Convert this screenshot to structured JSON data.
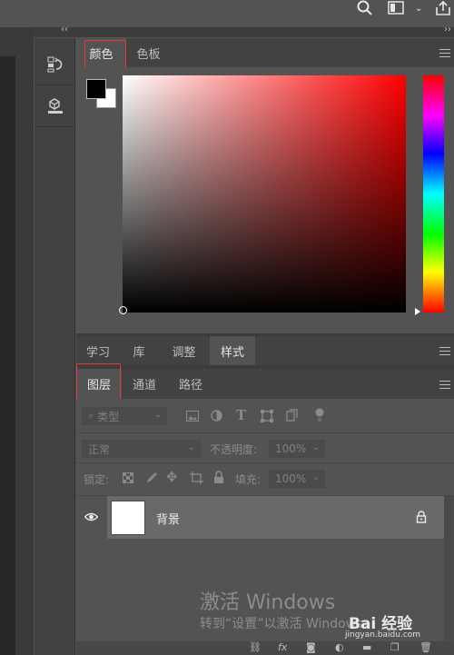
{
  "topbar": {
    "icons": [
      "search-icon",
      "workspace-icon",
      "chevron-down-icon",
      "share-icon"
    ]
  },
  "collapse": {
    "left": "‹‹",
    "right": "››"
  },
  "dock": {
    "items": [
      "history-icon",
      "3d-panel-icon"
    ]
  },
  "color_panel": {
    "tabs": [
      {
        "label": "颜色"
      },
      {
        "label": "色板"
      }
    ],
    "foreground": "#000000",
    "background": "#ffffff"
  },
  "mid_tabs": [
    {
      "label": "学习"
    },
    {
      "label": "库"
    },
    {
      "label": "调整"
    },
    {
      "label": "样式"
    }
  ],
  "layers_panel": {
    "tabs": [
      {
        "label": "图层"
      },
      {
        "label": "通道"
      },
      {
        "label": "路径"
      }
    ],
    "filter_placeholder": "类型",
    "blend_mode": "正常",
    "opacity_label": "不透明度:",
    "opacity_value": "100%",
    "lock_label": "锁定:",
    "fill_label": "填充:",
    "fill_value": "100%",
    "layers": [
      {
        "name": "背景",
        "visible": true,
        "locked": true
      }
    ]
  },
  "bottom_icons": [
    "link-icon",
    "fx",
    "mask-icon",
    "adjustment-icon",
    "folder-icon",
    "new-layer-icon",
    "trash-icon"
  ],
  "watermark": {
    "line1": "激活 Windows",
    "line2": "转到“设置”以激活 Windows。",
    "brand": "Bai 经验",
    "url": "jingyan.baidu.com"
  },
  "colors": {
    "accent_box": "#e53935"
  }
}
